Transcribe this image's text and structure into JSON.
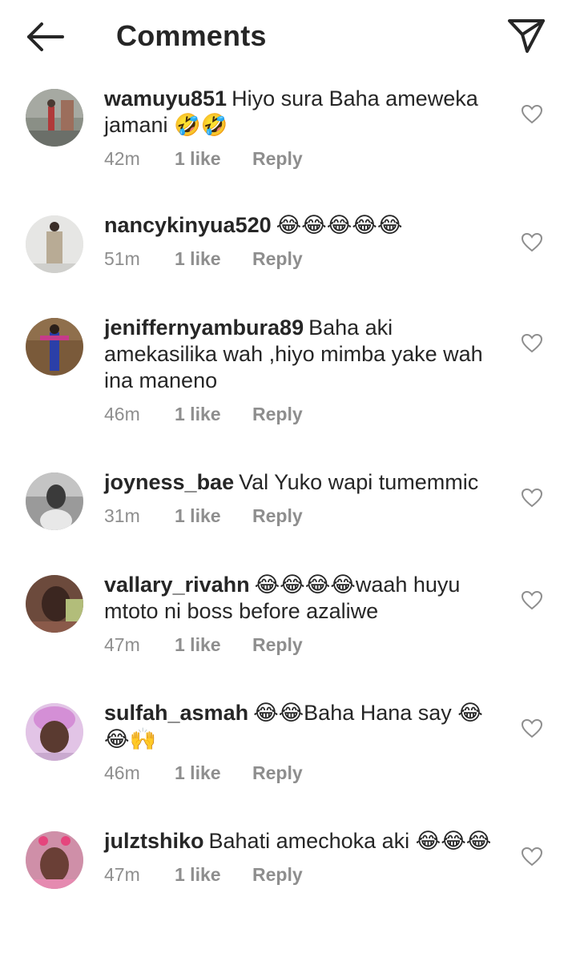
{
  "header": {
    "title": "Comments"
  },
  "icons": {
    "back": "arrow-left-icon",
    "share": "paper-plane-icon",
    "like": "heart-outline-icon"
  },
  "comments": [
    {
      "username": "wamuyu851",
      "text": "Hiyo sura Baha ameweka jamani 🤣🤣",
      "time": "42m",
      "likes": "1 like",
      "reply": "Reply"
    },
    {
      "username": "nancykinyua520",
      "text": "😂😂😂😂😂",
      "time": "51m",
      "likes": "1 like",
      "reply": "Reply"
    },
    {
      "username": "jeniffernyambura89",
      "text": "Baha aki amekasilika wah ,hiyo mimba yake wah ina maneno",
      "time": "46m",
      "likes": "1 like",
      "reply": "Reply"
    },
    {
      "username": "joyness_bae",
      "text": "Val Yuko wapi tumemmic",
      "time": "31m",
      "likes": "1 like",
      "reply": "Reply"
    },
    {
      "username": "vallary_rivahn",
      "text": "😂😂😂😂waah huyu mtoto ni boss before azaliwe",
      "time": "47m",
      "likes": "1 like",
      "reply": "Reply"
    },
    {
      "username": "sulfah_asmah",
      "text": "😂😂Baha Hana say 😂😂🙌",
      "time": "46m",
      "likes": "1 like",
      "reply": "Reply"
    },
    {
      "username": "julztshiko",
      "text": "Bahati amechoka aki 😂😂😂",
      "time": "47m",
      "likes": "1 like",
      "reply": "Reply"
    }
  ]
}
